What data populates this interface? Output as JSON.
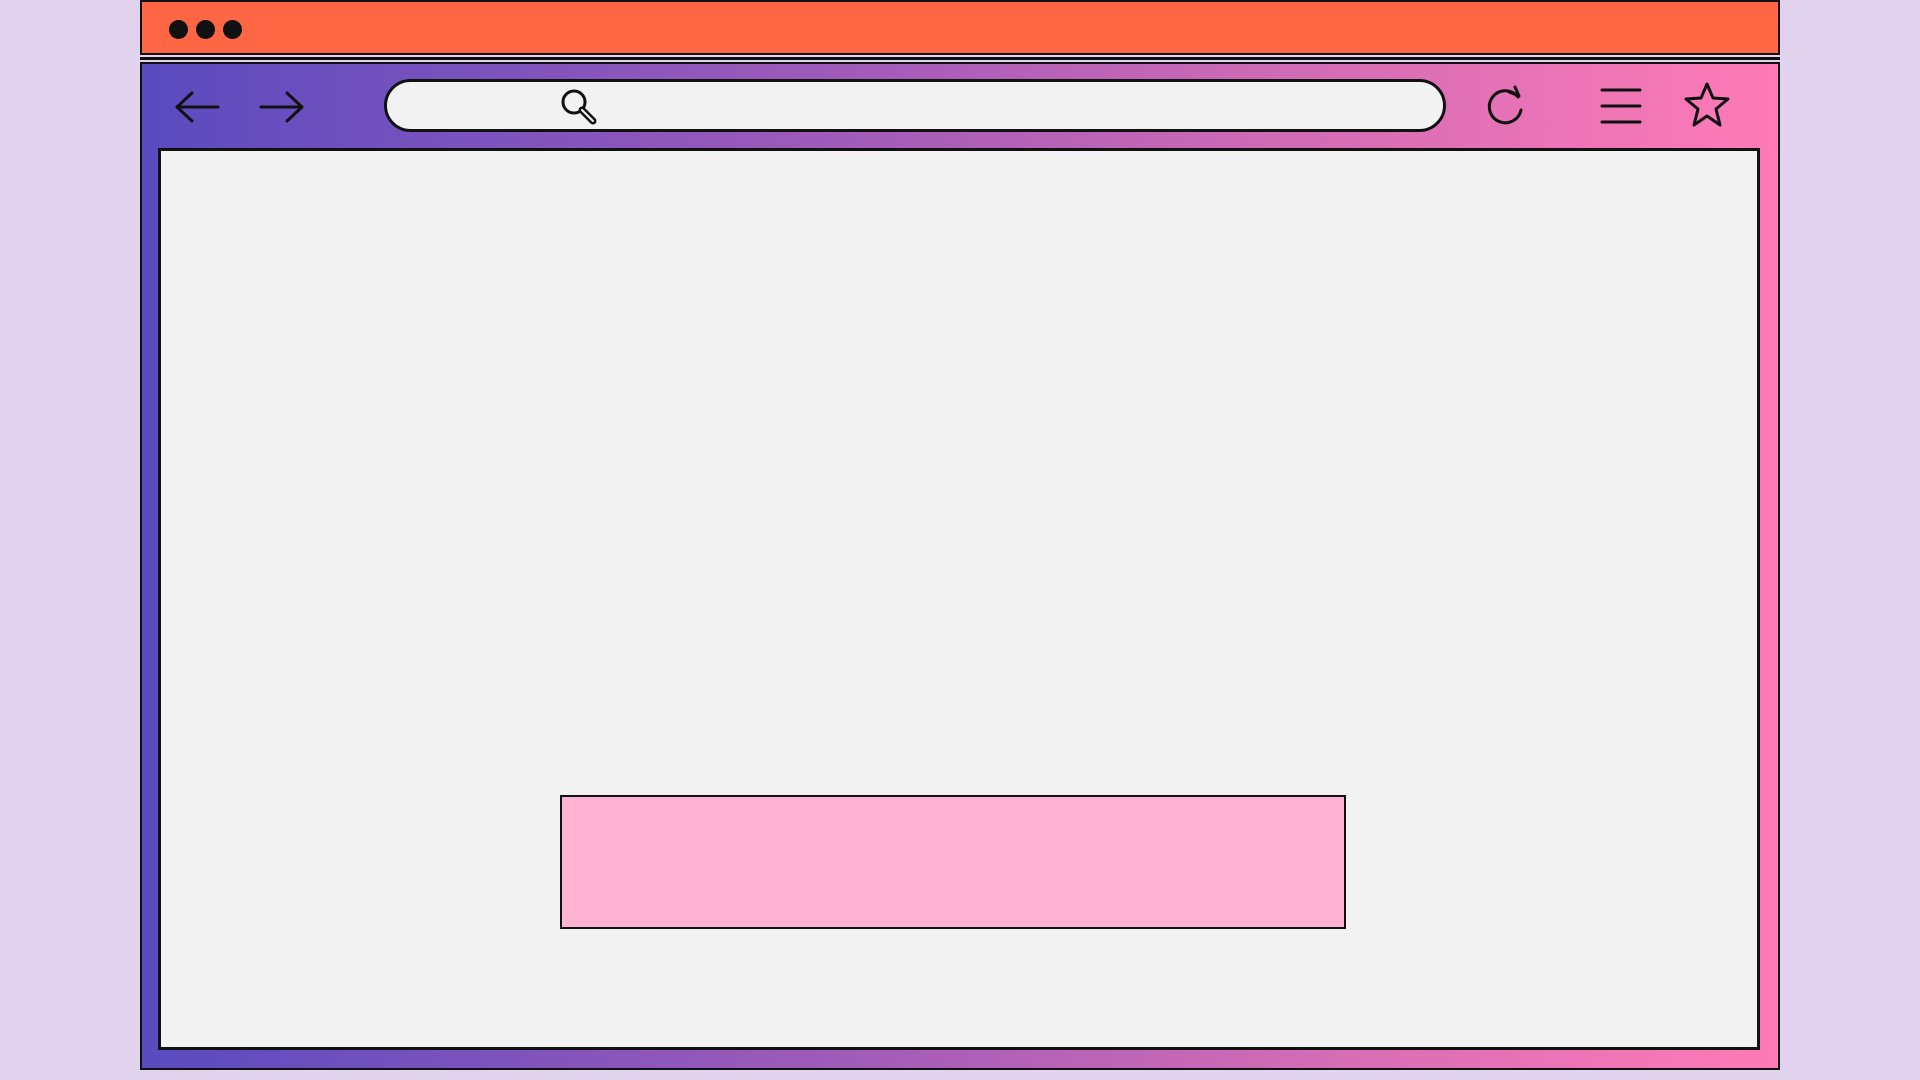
{
  "window": {
    "titlebar_color": "#FF6643",
    "background_color": "#E1D2EE",
    "gradient_colors": [
      "#5A4BBF",
      "#A45CB9",
      "#FF7BB6"
    ],
    "window_controls": [
      "dot",
      "dot",
      "dot"
    ]
  },
  "toolbar": {
    "back_icon": "arrow-left-icon",
    "forward_icon": "arrow-right-icon",
    "reload_icon": "reload-icon",
    "menu_icon": "hamburger-menu-icon",
    "bookmark_icon": "star-icon"
  },
  "address_bar": {
    "icon": "search-icon",
    "value": "",
    "placeholder": ""
  },
  "content": {
    "background_color": "#F2F2F2",
    "banner_color": "#FFB2D2"
  }
}
